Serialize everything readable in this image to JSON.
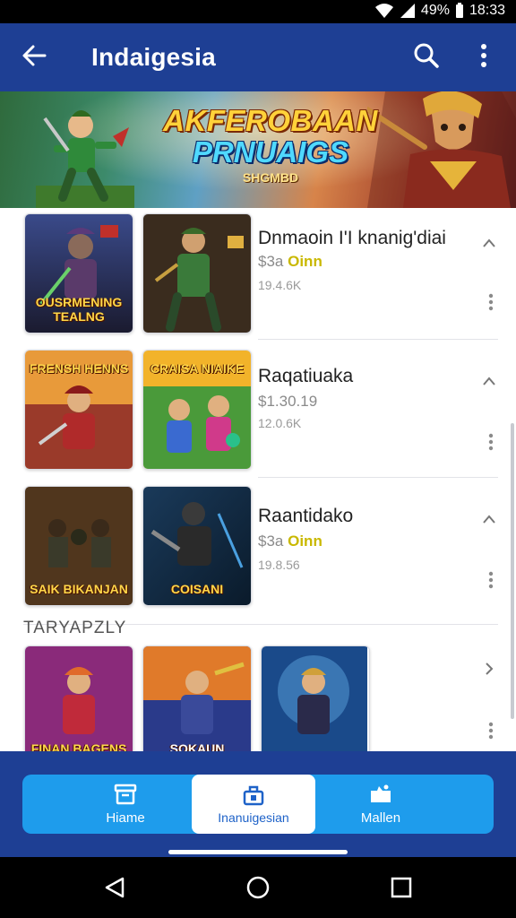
{
  "status_bar": {
    "battery": "49%",
    "time": "18:33"
  },
  "app_bar": {
    "title": "Indaigesia"
  },
  "banner": {
    "title": "AKFEROBAAN",
    "subtitle": "PRNUAIGS",
    "tag": "SHGMBD"
  },
  "apps": [
    {
      "title": "Dnmaoin I'I knanig'diai",
      "price_prefix": "$3a",
      "price_coin": "Oinn",
      "size": "19.4.6K",
      "thumb_left_caption": "OUSRMENING TEALNG",
      "thumb_right_caption": ""
    },
    {
      "title": "Raqatiuaka",
      "price_prefix": "$1.30.19",
      "price_coin": "",
      "size": "12.0.6K",
      "thumb_left_caption": "FRENSH HENNS",
      "thumb_right_caption": "CRAISA NIAIKE"
    },
    {
      "title": "Raantidako",
      "price_prefix": "$3a",
      "price_coin": "Oinn",
      "size": "19.8.56",
      "thumb_left_caption": "SAIK BIKANJAN",
      "thumb_right_caption": "COISANI"
    }
  ],
  "section_label": "TARYAPZLY",
  "more_apps": [
    {
      "caption": "FINAN BAGENS"
    },
    {
      "caption": "SOKAUN"
    },
    {
      "caption": ""
    }
  ],
  "bottom_nav": {
    "items": [
      {
        "label": "Hiame"
      },
      {
        "label": "Inanuigesian"
      },
      {
        "label": "Mallen"
      }
    ]
  },
  "colors": {
    "app_bar": "#1e3f94",
    "nav_bar": "#1e9cec",
    "price_coin": "#c9b800"
  },
  "icons": [
    "back-arrow-icon",
    "search-icon",
    "more-vert-icon",
    "chevron-icon",
    "home-icon",
    "store-icon",
    "menu-icon",
    "back-triangle-icon",
    "home-circle-icon",
    "recents-square-icon"
  ]
}
